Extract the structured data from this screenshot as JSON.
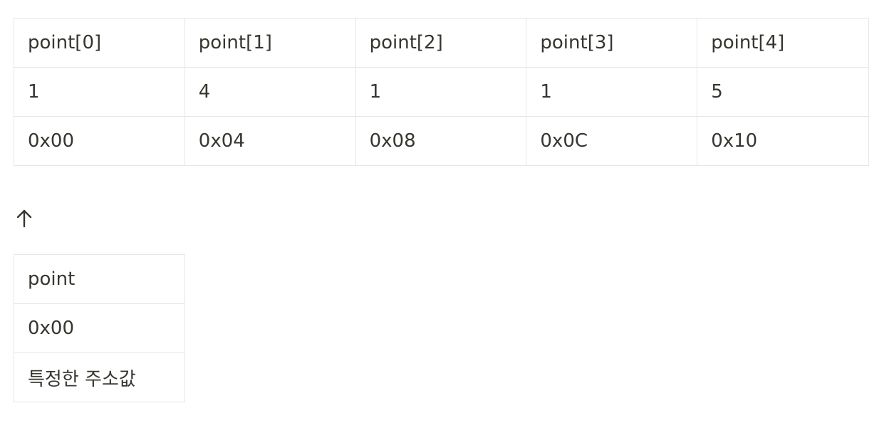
{
  "array_table": {
    "headers": [
      "point[0]",
      "point[1]",
      "point[2]",
      "point[3]",
      "point[4]"
    ],
    "values": [
      "1",
      "4",
      "1",
      "1",
      "5"
    ],
    "addresses": [
      "0x00",
      "0x04",
      "0x08",
      "0x0C",
      "0x10"
    ]
  },
  "arrow": {
    "icon": "arrow-up-icon"
  },
  "pointer_table": {
    "name": "point",
    "address": "0x00",
    "description": "특정한 주소값"
  }
}
